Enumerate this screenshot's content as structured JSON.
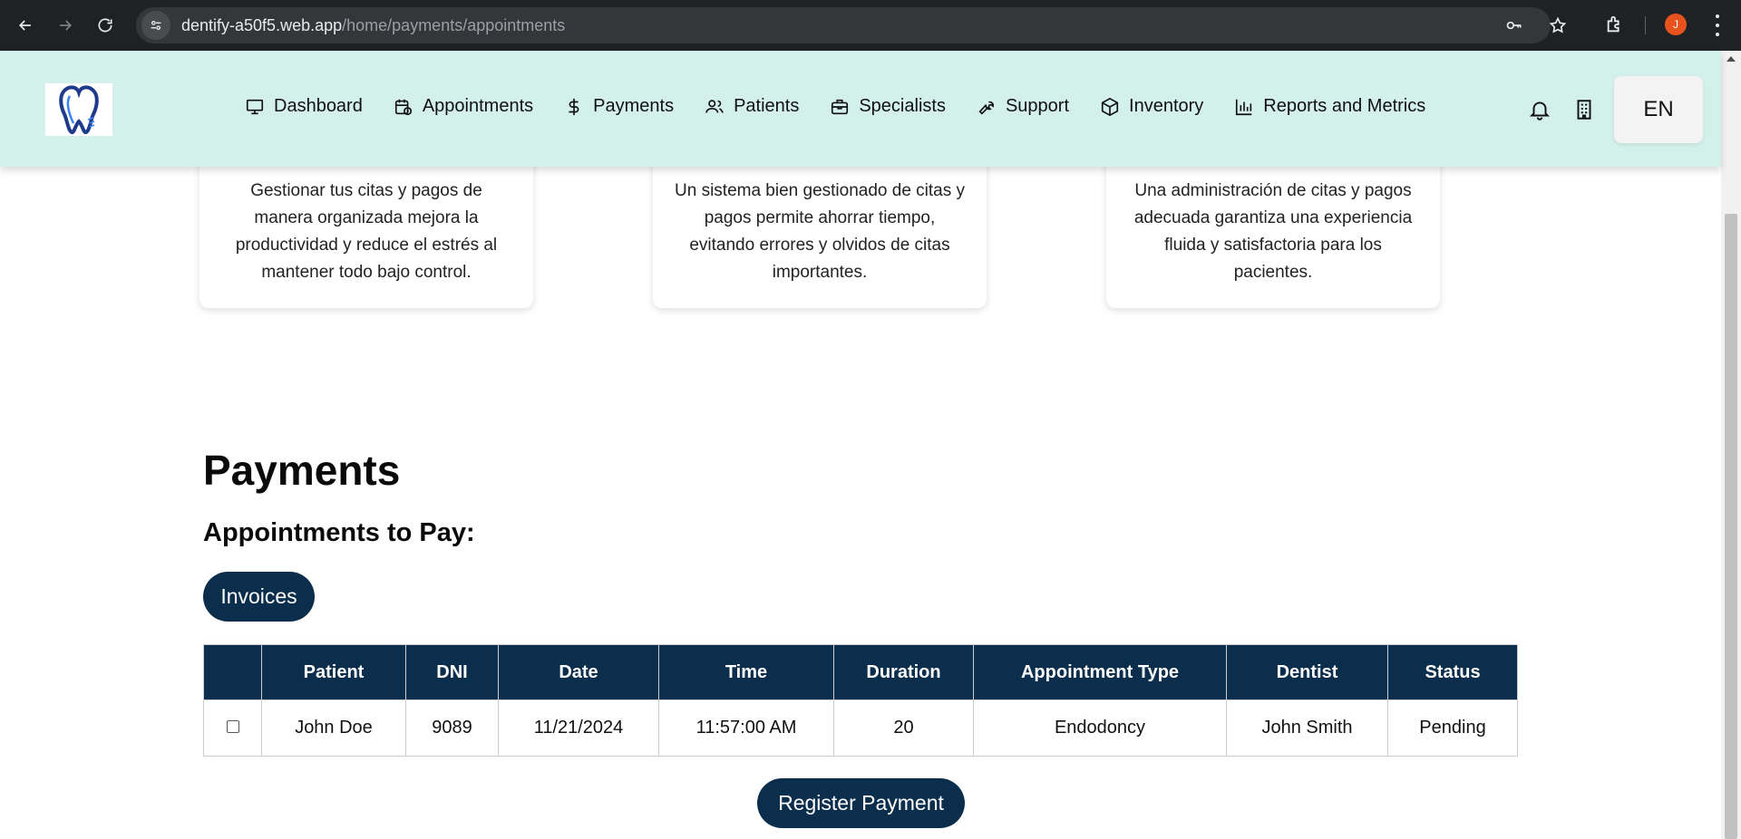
{
  "browser": {
    "url_host": "dentify-a50f5.web.app",
    "url_path": "/home/payments/appointments",
    "profile_initial": "J"
  },
  "header": {
    "nav": [
      {
        "label": "Dashboard",
        "icon": "monitor-icon"
      },
      {
        "label": "Appointments",
        "icon": "calendar-clock-icon"
      },
      {
        "label": "Payments",
        "icon": "dollar-icon"
      },
      {
        "label": "Patients",
        "icon": "users-icon"
      },
      {
        "label": "Specialists",
        "icon": "briefcase-icon"
      },
      {
        "label": "Support",
        "icon": "wrench-icon"
      },
      {
        "label": "Inventory",
        "icon": "box-icon"
      },
      {
        "label": "Reports and Metrics",
        "icon": "bar-chart-icon"
      }
    ],
    "language": "EN"
  },
  "cards": [
    {
      "text": "Gestionar tus citas y pagos de manera organizada mejora la productividad y reduce el estrés al mantener todo bajo control."
    },
    {
      "text": "Un sistema bien gestionado de citas y pagos permite ahorrar tiempo, evitando errores y olvidos de citas importantes."
    },
    {
      "text": "Una administración de citas y pagos adecuada garantiza una experiencia fluida y satisfactoria para los pacientes."
    }
  ],
  "payments": {
    "title": "Payments",
    "subtitle": "Appointments to Pay:",
    "invoices_label": "Invoices",
    "register_label": "Register Payment",
    "columns": [
      "",
      "Patient",
      "DNI",
      "Date",
      "Time",
      "Duration",
      "Appointment Type",
      "Dentist",
      "Status"
    ],
    "rows": [
      {
        "patient": "John Doe",
        "dni": "9089",
        "date": "11/21/2024",
        "time": "11:57:00 AM",
        "duration": "20",
        "type": "Endodoncy",
        "dentist": "John Smith",
        "status": "Pending"
      }
    ]
  },
  "colors": {
    "header_bg": "#d4f0ea",
    "primary": "#0b2e4d"
  }
}
